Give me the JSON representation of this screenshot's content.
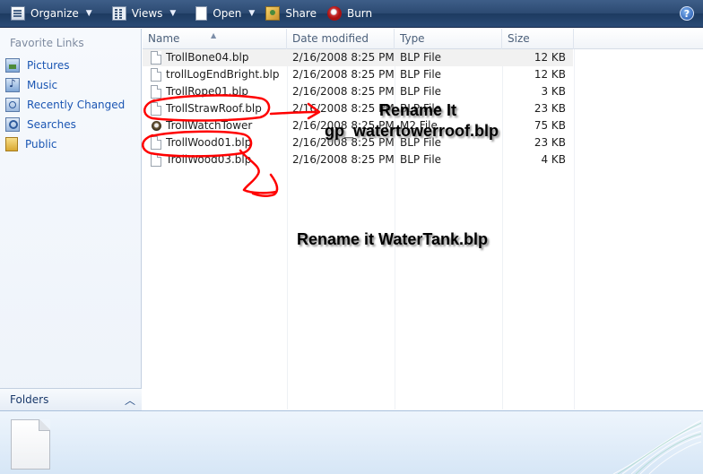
{
  "toolbar": {
    "organize": "Organize",
    "views": "Views",
    "open": "Open",
    "share": "Share",
    "burn": "Burn",
    "help": "?"
  },
  "nav": {
    "favorites_title": "Favorite Links",
    "items": [
      {
        "label": "Pictures",
        "icon": "pictures-icon"
      },
      {
        "label": "Music",
        "icon": "music-icon"
      },
      {
        "label": "Recently Changed",
        "icon": "recently-changed-icon"
      },
      {
        "label": "Searches",
        "icon": "searches-icon"
      },
      {
        "label": "Public",
        "icon": "public-folder-icon"
      }
    ],
    "folders_label": "Folders"
  },
  "columns": {
    "name": "Name",
    "date": "Date modified",
    "type": "Type",
    "size": "Size"
  },
  "files": [
    {
      "name": "TrollBone04.blp",
      "date": "2/16/2008 8:25 PM",
      "type": "BLP File",
      "size": "12 KB"
    },
    {
      "name": "trollLogEndBright.blp",
      "date": "2/16/2008 8:25 PM",
      "type": "BLP File",
      "size": "12 KB"
    },
    {
      "name": "TrollRope01.blp",
      "date": "2/16/2008 8:25 PM",
      "type": "BLP File",
      "size": "3 KB"
    },
    {
      "name": "TrollStrawRoof.blp",
      "date": "2/16/2008 8:25 PM",
      "type": "BLP File",
      "size": "23 KB"
    },
    {
      "name": "TrollWatchTower",
      "date": "2/16/2008 8:25 PM",
      "type": "M2 File",
      "size": "75 KB"
    },
    {
      "name": "TrollWood01.blp",
      "date": "2/16/2008 8:25 PM",
      "type": "BLP File",
      "size": "23 KB"
    },
    {
      "name": "TrollWood03.blp",
      "date": "2/16/2008 8:25 PM",
      "type": "BLP File",
      "size": "4 KB"
    }
  ],
  "annotations": {
    "rename1_line1": "Rename It",
    "rename1_line2": "gp_watertowerroof.blp",
    "rename2": "Rename it WaterTank.blp",
    "color": "#ff0000"
  }
}
